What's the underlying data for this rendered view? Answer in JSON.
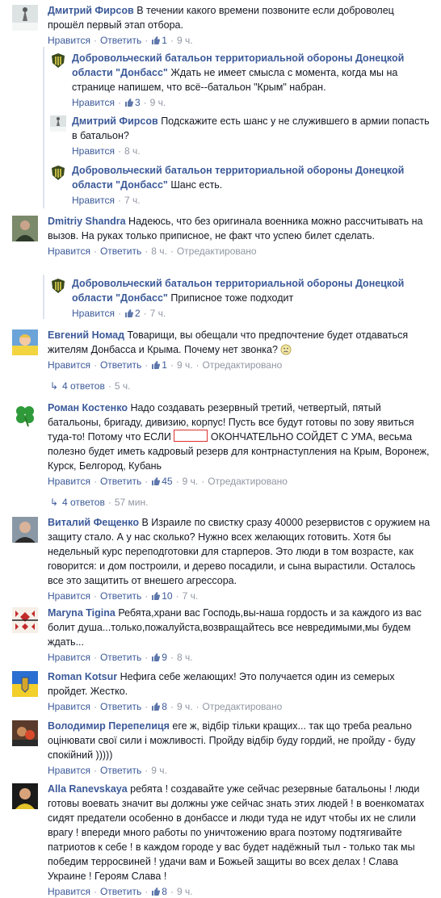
{
  "ui": {
    "like": "Нравится",
    "reply": "Ответить",
    "edited": "Отредактировано",
    "dot": "·"
  },
  "comments": [
    {
      "author": "Дмитрий Фирсов",
      "text": "В течении какого времени позвоните если доброволец прошёл первый этап отбора.",
      "likes": "1",
      "time": "9 ч.",
      "edited": false
    },
    {
      "author": "Добровольческий батальон территориальной обороны Донецкой области \"Донбасс\"",
      "text": "Ждать не имеет смысла с момента, когда мы на странице напишем, что всё--батальон \"Крым\" набран.",
      "likes": "3",
      "time": "9 ч."
    },
    {
      "author": "Дмитрий Фирсов",
      "text": "Подскажите есть шанс у не служившего в армии попасть в батальон?",
      "time": "8 ч."
    },
    {
      "author": "Добровольческий батальон территориальной обороны Донецкой области \"Донбасс\"",
      "text": "Шанс есть.",
      "time": "7 ч."
    },
    {
      "author": "Dmitriy Shandra",
      "text": "Надеюсь, что без оригинала военника можно рассчитывать на вызов. На руках только приписное, не факт что успею билет сделать.",
      "time": "8 ч."
    },
    {
      "author": "Добровольческий батальон территориальной обороны Донецкой области \"Донбасс\"",
      "text": "Приписное тоже подходит",
      "likes": "2",
      "time": "7 ч."
    },
    {
      "author": "Евгений Номад",
      "text": "Товарищи, вы обещали что предпочтение будет отдаваться жителям Донбасса и Крыма. Почему нет звонка?",
      "likes": "1",
      "time": "9 ч.",
      "replies": "4 ответов",
      "replies_time": "5 ч."
    },
    {
      "author": "Роман Костенко",
      "text_a": "Надо создавать резервный третий, четвертый, пятый батальоны, бригаду, дивизию, корпус! Пусть все будут готовы по зову явиться туда-то! Потому что ЕСЛИ",
      "text_b": "ОКОНЧАТЕЛЬНО СОЙДЕТ С УМА, весьма полезно будет иметь кадровый резерв для контрнаступления на Крым, Воронеж, Курск, Белгород, Кубань",
      "likes": "45",
      "time": "9 ч.",
      "replies": "4 ответов",
      "replies_time": "57 мин."
    },
    {
      "author": "Виталий Фещенко",
      "text": "В Израиле по свистку сразу 40000 резервистов с оружием на защиту стало. А у нас сколько? Нужно всех желающих готовить. Хотя бы недельный курс переподготовки для старперов. Это люди в том возрасте, как говорится: и дом построили, и дерево посадили, и сына вырастили. Осталось все это защитить от внешего агрессора.",
      "likes": "10",
      "time": "7 ч."
    },
    {
      "author": "Maryna Tigina",
      "text": "Ребята,храни вас Господь,вы-наша гордость и за каждого из вас болит душа...только,пожалуйста,возвращайтесь все невредимыми,мы будем ждать...",
      "likes": "9",
      "time": "8 ч."
    },
    {
      "author": "Roman Kotsur",
      "text": "Нефига себе желающих! Это получается один из семерых пройдет. Жестко.",
      "likes": "8",
      "time": "9 ч."
    },
    {
      "author": "Володимир Перепелиця",
      "text": "еге ж, відбір тільки кращих... так що треба реально оцінювати свої сили і можливості. Пройду відбір буду гордий, не пройду - буду спокійний )))))",
      "time": "9 ч."
    },
    {
      "author": "Alla Ranevskaya",
      "text": "ребята ! создавайте уже сейчас резервные батальоны ! люди готовы воевать значит вы должны уже сейчас знать этих людей ! в военкоматах сидят предатели особенно в донбассе и люди туда не идут чтобы их не слили врагу ! впереди много работы по уничтожению врага поэтому подтягивайте патриотов к себе ! в каждом городе у вас будет надёжный тыл - только так мы победим терросвиней ! удачи вам и Божьей защиты во всех делах ! Слава Украине ! Героям Слава !",
      "likes": "8",
      "time": "9 ч."
    }
  ]
}
